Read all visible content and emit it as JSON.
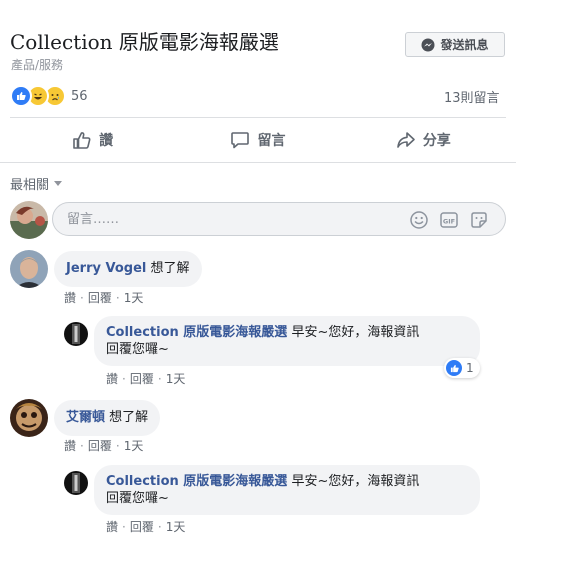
{
  "page": {
    "title": "Collection 原版電影海報嚴選",
    "category": "產品/服務",
    "send_message_label": "發送訊息"
  },
  "reactions": {
    "count": "56",
    "comments_count": "13則留言"
  },
  "actions": {
    "like": "讚",
    "comment": "留言",
    "share": "分享"
  },
  "sort": {
    "label": "最相關"
  },
  "compose": {
    "placeholder": "留言……"
  },
  "comments": [
    {
      "author": "Jerry Vogel",
      "text": "想了解",
      "like": "讚",
      "reply": "回覆",
      "time": "1天",
      "reply_item": {
        "author": "Collection 原版電影海報嚴選",
        "line1": "早安~您好，海報資訊",
        "line2": "回覆您囉~",
        "like": "讚",
        "reply": "回覆",
        "time": "1天",
        "like_count": "1"
      }
    },
    {
      "author": "艾爾頓",
      "text": "想了解",
      "like": "讚",
      "reply": "回覆",
      "time": "1天",
      "reply_item": {
        "author": "Collection 原版電影海報嚴選",
        "line1": "早安~您好，海報資訊",
        "line2": "回覆您囉~",
        "like": "讚",
        "reply": "回覆",
        "time": "1天"
      }
    }
  ]
}
